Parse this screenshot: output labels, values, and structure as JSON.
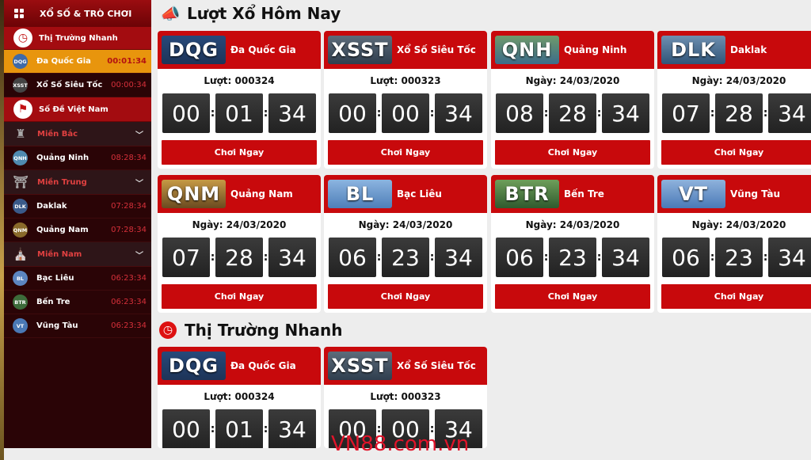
{
  "sidebar": {
    "header": "XỔ SỐ & TRÒ CHƠI",
    "fast_market": "Thị Trường Nhanh",
    "fast_items": [
      {
        "abbr": "DQG",
        "name": "Đa Quốc Gia",
        "time": "00:01:34",
        "active": true
      },
      {
        "abbr": "XSST",
        "name": "Xổ Số Siêu Tốc",
        "time": "00:00:34",
        "active": false
      }
    ],
    "so_de": "Số Đề Việt Nam",
    "regions": [
      {
        "name": "Miền Bắc",
        "items": [
          {
            "abbr": "QNH",
            "name": "Quảng Ninh",
            "time": "08:28:34"
          }
        ]
      },
      {
        "name": "Miền Trung",
        "items": [
          {
            "abbr": "DLK",
            "name": "Daklak",
            "time": "07:28:34"
          },
          {
            "abbr": "QNM",
            "name": "Quảng Nam",
            "time": "07:28:34"
          }
        ]
      },
      {
        "name": "Miền Nam",
        "items": [
          {
            "abbr": "BL",
            "name": "Bạc Liêu",
            "time": "06:23:34"
          },
          {
            "abbr": "BTR",
            "name": "Bến Tre",
            "time": "06:23:34"
          },
          {
            "abbr": "VT",
            "name": "Vũng Tàu",
            "time": "06:23:34"
          }
        ]
      }
    ]
  },
  "today": {
    "title": "Lượt Xổ Hôm Nay",
    "cards": [
      {
        "abbr": "DQG",
        "name": "Đa Quốc Gia",
        "sub": "Lượt: 000324",
        "h": "00",
        "m": "01",
        "s": "34",
        "button": "Chơi Ngay"
      },
      {
        "abbr": "XSST",
        "name": "Xổ Số Siêu Tốc",
        "sub": "Lượt: 000323",
        "h": "00",
        "m": "00",
        "s": "34",
        "button": "Chơi Ngay"
      },
      {
        "abbr": "QNH",
        "name": "Quảng Ninh",
        "sub": "Ngày: 24/03/2020",
        "h": "08",
        "m": "28",
        "s": "34",
        "button": "Chơi Ngay"
      },
      {
        "abbr": "DLK",
        "name": "Daklak",
        "sub": "Ngày: 24/03/2020",
        "h": "07",
        "m": "28",
        "s": "34",
        "button": "Chơi Ngay"
      },
      {
        "abbr": "QNM",
        "name": "Quảng Nam",
        "sub": "Ngày: 24/03/2020",
        "h": "07",
        "m": "28",
        "s": "34",
        "button": "Chơi Ngay"
      },
      {
        "abbr": "BL",
        "name": "Bạc Liêu",
        "sub": "Ngày: 24/03/2020",
        "h": "06",
        "m": "23",
        "s": "34",
        "button": "Chơi Ngay"
      },
      {
        "abbr": "BTR",
        "name": "Bến Tre",
        "sub": "Ngày: 24/03/2020",
        "h": "06",
        "m": "23",
        "s": "34",
        "button": "Chơi Ngay"
      },
      {
        "abbr": "VT",
        "name": "Vũng Tàu",
        "sub": "Ngày: 24/03/2020",
        "h": "06",
        "m": "23",
        "s": "34",
        "button": "Chơi Ngay"
      }
    ]
  },
  "fast": {
    "title": "Thị Trường Nhanh",
    "cards": [
      {
        "abbr": "DQG",
        "name": "Đa Quốc Gia",
        "sub": "Lượt: 000324",
        "h": "00",
        "m": "01",
        "s": "34"
      },
      {
        "abbr": "XSST",
        "name": "Xổ Số Siêu Tốc",
        "sub": "Lượt: 000323",
        "h": "00",
        "m": "00",
        "s": "34"
      }
    ]
  },
  "watermark": "VN88.com.vn",
  "colors": {
    "primary": "#c8090c",
    "sidebar": "#2a0406",
    "active": "#e8950d"
  },
  "icons": {
    "header": "grid-icon",
    "fast_market": "clock-icon",
    "so_de": "flag-icon",
    "today": "megaphone-icon",
    "fast": "clock-icon"
  }
}
